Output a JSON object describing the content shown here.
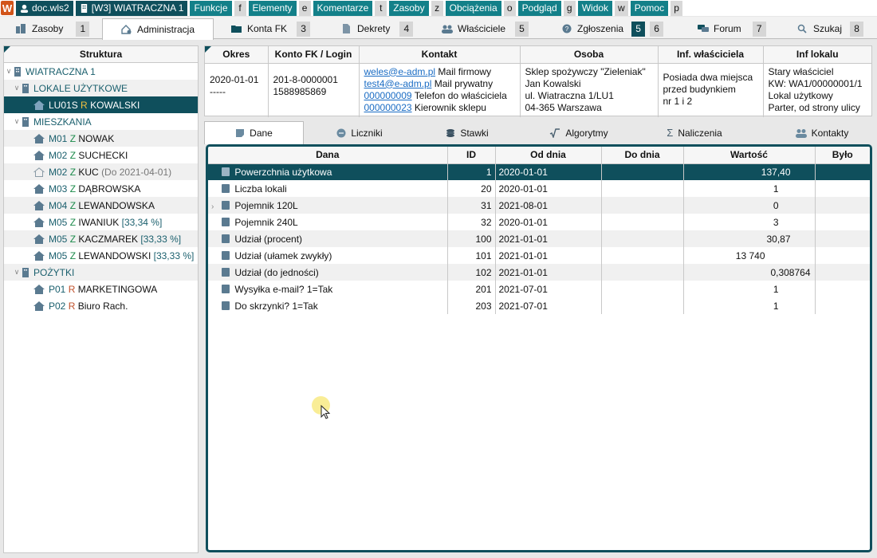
{
  "topbar": {
    "file": "doc.wls2",
    "building": "[W3] WIATRACZNA 1",
    "menus": [
      {
        "label": "Funkcje",
        "key": "f"
      },
      {
        "label": "Elementy",
        "key": "e"
      },
      {
        "label": "Komentarze",
        "key": "t"
      },
      {
        "label": "Zasoby",
        "key": "z"
      },
      {
        "label": "Obciążenia",
        "key": "o"
      },
      {
        "label": "Podgląd",
        "key": "g"
      },
      {
        "label": "Widok",
        "key": "w"
      },
      {
        "label": "Pomoc",
        "key": "p"
      }
    ]
  },
  "tabs": [
    {
      "label": "Zasoby",
      "num": "1",
      "icon": "buildings-icon"
    },
    {
      "label": "Administracja",
      "num": "",
      "icon": "admin-icon"
    },
    {
      "label": "Konta FK",
      "num": "3",
      "icon": "folder-icon"
    },
    {
      "label": "Dekrety",
      "num": "4",
      "icon": "document-icon"
    },
    {
      "label": "Właściciele",
      "num": "5",
      "icon": "people-icon"
    },
    {
      "label": "Zgłoszenia",
      "num": "5",
      "num2": "6",
      "icon": "help-icon"
    },
    {
      "label": "Forum",
      "num": "7",
      "icon": "chat-icon"
    },
    {
      "label": "Szukaj",
      "num": "8",
      "icon": "search-icon"
    }
  ],
  "tree": {
    "header": "Struktura",
    "root": "WIATRACZNA 1",
    "groups": [
      {
        "label": "LOKALE UŻYTKOWE",
        "items": [
          {
            "code": "LU01S",
            "type": "R",
            "name": "KOWALSKI",
            "extra": "",
            "selected": true
          }
        ]
      },
      {
        "label": "MIESZKANIA",
        "items": [
          {
            "code": "M01",
            "type": "Z",
            "name": "NOWAK",
            "extra": ""
          },
          {
            "code": "M02",
            "type": "Z",
            "name": "SUCHECKI",
            "extra": ""
          },
          {
            "code": "M02",
            "type": "Z",
            "name": "KUC",
            "extra": "(Do 2021-04-01)",
            "inactive": true
          },
          {
            "code": "M03",
            "type": "Z",
            "name": "DĄBROWSKA",
            "extra": ""
          },
          {
            "code": "M04",
            "type": "Z",
            "name": "LEWANDOWSKA",
            "extra": ""
          },
          {
            "code": "M05",
            "type": "Z",
            "name": "IWANIUK",
            "extra": "[33,34 %]"
          },
          {
            "code": "M05",
            "type": "Z",
            "name": "KACZMAREK",
            "extra": "[33,33 %]"
          },
          {
            "code": "M05",
            "type": "Z",
            "name": "LEWANDOWSKI",
            "extra": "[33,33 %]"
          }
        ]
      },
      {
        "label": "POŻYTKI",
        "items": [
          {
            "code": "P01",
            "type": "R",
            "name": "MARKETINGOWA",
            "extra": ""
          },
          {
            "code": "P02",
            "type": "R",
            "name": "Biuro Rach.",
            "extra": ""
          }
        ]
      }
    ]
  },
  "info": {
    "headers": [
      "Okres",
      "Konto FK / Login",
      "Kontakt",
      "Osoba",
      "Inf. właściciela",
      "Inf lokalu"
    ],
    "okres": [
      "2020-01-01",
      "-----"
    ],
    "konto": [
      "201-8-0000001",
      "1588985869"
    ],
    "kontakt": [
      {
        "link": "weles@e-adm.pl",
        "label": "Mail firmowy"
      },
      {
        "link": "test4@e-adm.pl",
        "label": "Mail prywatny"
      },
      {
        "link": "000000009",
        "label": "Telefon do właściciela"
      },
      {
        "link": "000000023",
        "label": "Kierownik sklepu"
      }
    ],
    "osoba": [
      "Sklep spożywczy \"Zieleniak\"",
      "Jan Kowalski",
      "ul. Wiatraczna 1/LU1",
      "04-365 Warszawa"
    ],
    "wlasciciel": [
      "Posiada dwa miejsca",
      "przed budynkiem",
      "nr 1 i 2"
    ],
    "lokal": [
      "Stary właściciel",
      "KW: WA1/00000001/1",
      "Lokal użytkowy",
      "Parter, od strony ulicy"
    ]
  },
  "subtabs": [
    {
      "label": "Dane",
      "icon": "note-icon",
      "active": true
    },
    {
      "label": "Liczniki",
      "icon": "meter-icon"
    },
    {
      "label": "Stawki",
      "icon": "coins-icon"
    },
    {
      "label": "Algorytmy",
      "icon": "sqrt-icon"
    },
    {
      "label": "Naliczenia",
      "icon": "sigma-icon"
    },
    {
      "label": "Kontakty",
      "icon": "contacts-icon"
    }
  ],
  "grid": {
    "headers": [
      "Dana",
      "ID",
      "Od dnia",
      "Do dnia",
      "Wartość",
      "Było"
    ],
    "rows": [
      {
        "dana": "Powerzchnia użytkowa",
        "id": "1",
        "od": "2020-01-01",
        "do": "",
        "wartosc": "137,40",
        "bylo": "",
        "selected": true
      },
      {
        "dana": "Liczba lokali",
        "id": "20",
        "od": "2020-01-01",
        "do": "",
        "wartosc": "1",
        "bylo": ""
      },
      {
        "dana": "Pojemnik 120L",
        "id": "31",
        "od": "2021-08-01",
        "do": "",
        "wartosc": "0",
        "bylo": "",
        "expandable": true
      },
      {
        "dana": "Pojemnik 240L",
        "id": "32",
        "od": "2020-01-01",
        "do": "",
        "wartosc": "3",
        "bylo": ""
      },
      {
        "dana": "Udział (procent)",
        "id": "100",
        "od": "2021-01-01",
        "do": "",
        "wartosc": "30,87",
        "bylo": ""
      },
      {
        "dana": "Udział (ułamek zwykły)",
        "id": "101",
        "od": "2021-01-01",
        "do": "",
        "wartosc": "13 740",
        "bylo": ""
      },
      {
        "dana": "Udział (do jedności)",
        "id": "102",
        "od": "2021-01-01",
        "do": "",
        "wartosc": "0,308764",
        "bylo": ""
      },
      {
        "dana": "Wysyłka e-mail? 1=Tak",
        "id": "201",
        "od": "2021-07-01",
        "do": "",
        "wartosc": "1",
        "bylo": ""
      },
      {
        "dana": "Do skrzynki? 1=Tak",
        "id": "203",
        "od": "2021-07-01",
        "do": "",
        "wartosc": "1",
        "bylo": ""
      }
    ]
  }
}
